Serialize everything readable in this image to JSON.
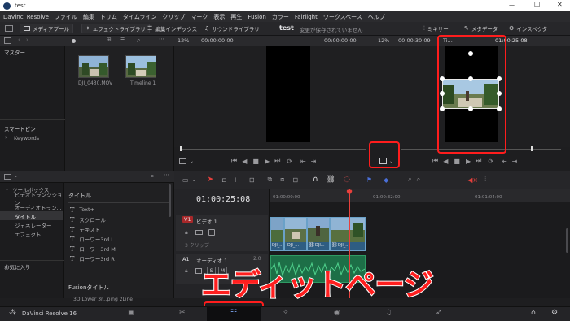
{
  "window": {
    "title": "test",
    "minimize": "—",
    "maximize": "☐",
    "close": "✕"
  },
  "menu": [
    "DaVinci Resolve",
    "ファイル",
    "編集",
    "トリム",
    "タイムライン",
    "クリップ",
    "マーク",
    "表示",
    "再生",
    "Fusion",
    "カラー",
    "Fairlight",
    "ワークスペース",
    "ヘルプ"
  ],
  "toolbar": {
    "media_pool": "メディアプール",
    "effects_library": "エフェクトライブラリ",
    "edit_index": "編集インデックス",
    "sound_library": "サウンドライブラリ",
    "project_name": "test",
    "save_status": "変更が保存されていません",
    "mixer": "ミキサー",
    "metadata": "メタデータ",
    "inspector": "インスペクタ"
  },
  "viewer_bar": {
    "source_zoom": "12%",
    "source_timecode": "00:00:00:00",
    "source_end_timecode": "00:00:00:00",
    "timeline_zoom": "12%",
    "timeline_duration": "00:00:30:09",
    "timeline_name": "Ti...",
    "timeline_timecode": "01:00:25:08"
  },
  "media_pool": {
    "folder": "マスター",
    "clips": [
      {
        "name": "DJI_0430.MOV"
      },
      {
        "name": "Timeline 1"
      }
    ],
    "smart_bins": "スマートビン",
    "keywords": "Keywords"
  },
  "effects": {
    "toolbox": "ツールボックス",
    "items": [
      "ビデオトランジション",
      "オーディオトラン...",
      "タイトル",
      "ジェネレーター",
      "エフェクト"
    ],
    "selected_index": 2,
    "favorites": "お気に入り",
    "section_title": "タイトル",
    "titles": [
      "Text+",
      "スクロール",
      "テキスト",
      "ローワー3rd L",
      "ローワー3rd M",
      "ローワー3rd R"
    ],
    "fusion_title": "Fusionタイトル",
    "fusion_item": "3D Lower 3r...ping 2Line"
  },
  "timeline": {
    "timecode": "01:00:25:08",
    "ruler": [
      "01:00:00:00",
      "01:00:32:00",
      "01:01:04:00"
    ],
    "video_track": {
      "id": "V1",
      "name": "ビデオ 1",
      "clips_label": "3 クリップ"
    },
    "audio_track": {
      "id": "A1",
      "name": "オーディオ 1",
      "level": "2.0"
    },
    "video_clip_labels": [
      "DJI_...",
      "DJI_...",
      "DJI...",
      "DJI_..."
    ],
    "audio_buttons": [
      "S",
      "M"
    ]
  },
  "overlay_text": "エディットページ",
  "bottom_bar": {
    "app_name": "DaVinci Resolve 16"
  },
  "colors": {
    "accent_red": "#ff1d1d",
    "playhead": "#e8403c",
    "video_clip": "#2e5d82",
    "audio_clip": "#1d6f47"
  },
  "icons": [
    "resolve-logo-icon",
    "media-pool-icon",
    "effects-icon",
    "edit-index-icon",
    "sound-library-icon",
    "mixer-icon",
    "metadata-icon",
    "inspector-icon",
    "search-icon",
    "play-icon",
    "stop-icon",
    "loop-icon",
    "transform-icon",
    "blade-icon",
    "link-icon",
    "snap-icon",
    "home-icon",
    "gear-icon"
  ]
}
